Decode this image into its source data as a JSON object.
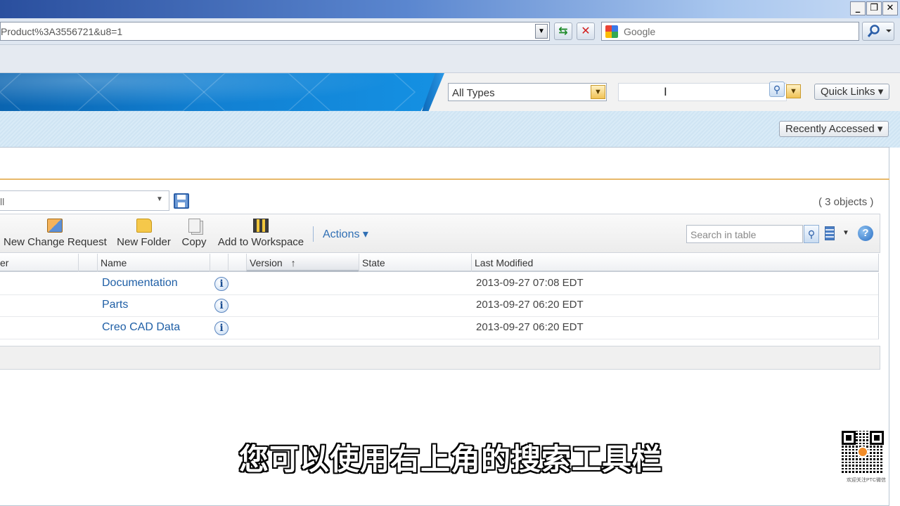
{
  "browser": {
    "url": "Product%3A3556721&u8=1",
    "search_engine": "Google",
    "window_buttons": [
      "_",
      "❐",
      "✕"
    ]
  },
  "header": {
    "type_filter": "All Types",
    "search_value": "",
    "quick_links": "Quick Links ▾",
    "recently_accessed": "Recently Accessed ▾"
  },
  "panel": {
    "view_value": "ll",
    "object_count": "( 3 objects )"
  },
  "toolbar": {
    "new_change_request": "New Change Request",
    "new_folder": "New Folder",
    "copy": "Copy",
    "add_to_workspace": "Add to Workspace",
    "actions": "Actions ▾",
    "search_placeholder": "Search in table"
  },
  "table": {
    "columns": [
      "er",
      "Name",
      "Version",
      "State",
      "Last Modified"
    ],
    "sort_indicator": "↑",
    "rows": [
      {
        "name": "Documentation",
        "state": "",
        "last_modified": "2013-09-27 07:08 EDT"
      },
      {
        "name": "Parts",
        "state": "",
        "last_modified": "2013-09-27 06:20 EDT"
      },
      {
        "name": "Creo CAD Data",
        "state": "",
        "last_modified": "2013-09-27 06:20 EDT"
      }
    ]
  },
  "subtitle": "您可以使用右上角的搜索工具栏",
  "watermark_caption": "欢迎关注PTC微信",
  "colors": {
    "accent_blue": "#117fd1",
    "link": "#1f5fa6",
    "header_rule": "#e8b86a"
  },
  "icons": [
    "refresh-icon",
    "stop-icon",
    "search-icon",
    "info-icon",
    "help-icon",
    "save-icon",
    "folder-icon",
    "copy-icon",
    "workspace-icon",
    "change-request-icon",
    "calculator-icon"
  ]
}
